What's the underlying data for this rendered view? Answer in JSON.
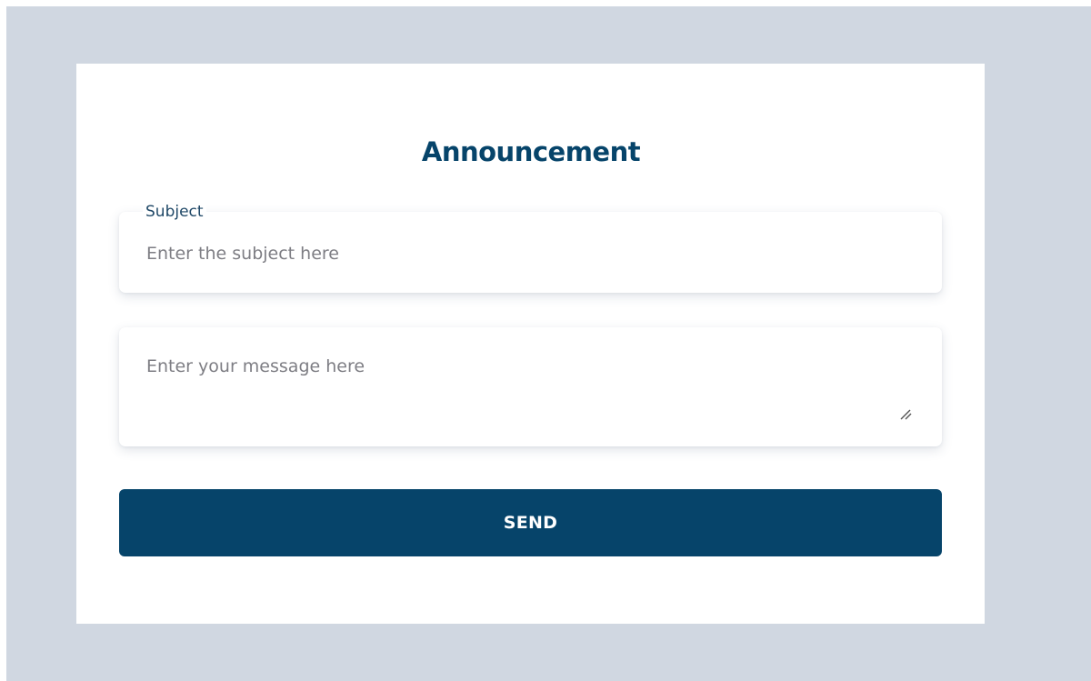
{
  "form": {
    "title": "Announcement",
    "subject": {
      "label": "Subject",
      "placeholder": "Enter the subject here",
      "value": ""
    },
    "message": {
      "placeholder": "Enter your message here",
      "value": ""
    },
    "send_label": "SEND"
  },
  "theme": {
    "backdrop": "#d0d7e1",
    "card": "#ffffff",
    "accent": "#06446a"
  },
  "icons": {
    "resize": "resize-handle-icon"
  }
}
